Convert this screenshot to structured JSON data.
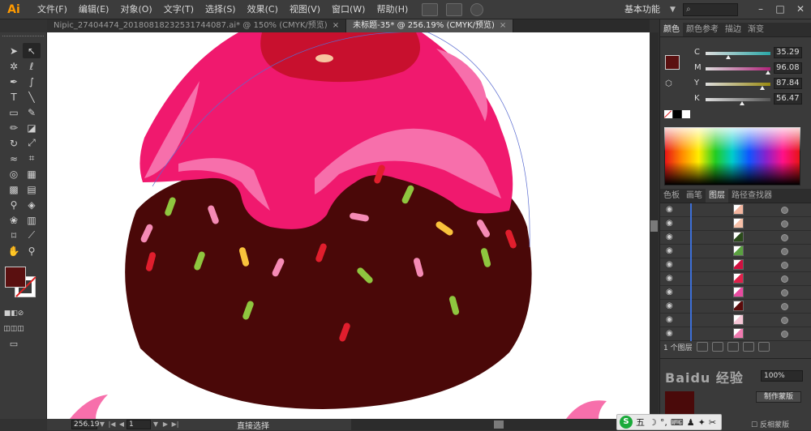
{
  "app": {
    "logo": "Ai",
    "workspace": "基本功能"
  },
  "menu": [
    "文件(F)",
    "编辑(E)",
    "对象(O)",
    "文字(T)",
    "选择(S)",
    "效果(C)",
    "视图(V)",
    "窗口(W)",
    "帮助(H)"
  ],
  "tabs": [
    {
      "label": "Nipic_27404474_20180818232531744087.ai* @ 150% (CMYK/预览)",
      "close": "×"
    },
    {
      "label": "未标题-35* @ 256.19% (CMYK/预览)",
      "close": "×"
    }
  ],
  "color_panel": {
    "tabs": [
      "颜色",
      "颜色参考",
      "描边",
      "渐变"
    ],
    "channels": [
      {
        "label": "C",
        "value": "35.29",
        "pct": 0.35,
        "track": "#2aa7a7"
      },
      {
        "label": "M",
        "value": "96.08",
        "pct": 0.96,
        "track": "#b0237a"
      },
      {
        "label": "Y",
        "value": "87.84",
        "pct": 0.88,
        "track": "#9a8a10"
      },
      {
        "label": "K",
        "value": "56.47",
        "pct": 0.56,
        "track": "#555555"
      }
    ],
    "fill_color": "#5a1010"
  },
  "layers_panel": {
    "tabs": [
      "色板",
      "画笔",
      "图层",
      "路径查找器"
    ],
    "rows": [
      {
        "thumb": "#f4b6a0"
      },
      {
        "thumb": "#f7c0a8"
      },
      {
        "thumb": "#2a4a1a"
      },
      {
        "thumb": "#5aa040"
      },
      {
        "thumb": "#d01040"
      },
      {
        "thumb": "#e0204a"
      },
      {
        "thumb": "#e84aa0"
      },
      {
        "thumb": "#5a0a0a"
      },
      {
        "thumb": "#f6c6d6"
      },
      {
        "thumb": "#f07ab0"
      }
    ],
    "footer": "1 个图层"
  },
  "transparency": {
    "opacity": "100%",
    "make_mask": "制作蒙版",
    "invert": "反相蒙版",
    "watermark": "Baidu 经验"
  },
  "status": {
    "zoom": "256.19",
    "page": "1",
    "tool": "直接选择"
  },
  "tray": {
    "ime": "五"
  },
  "colors": {
    "chocolate": "#4a0808",
    "pink_glaze": "#f0196e",
    "light_pink": "#f76fab",
    "cherry": "#c8102e"
  }
}
